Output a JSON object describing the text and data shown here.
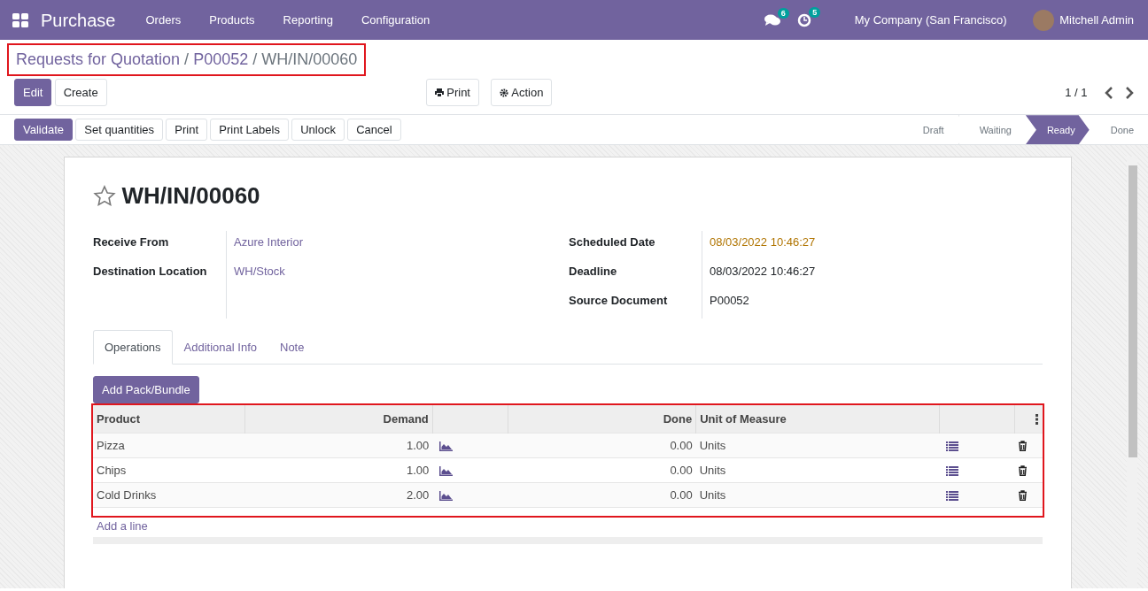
{
  "navbar": {
    "app": "Purchase",
    "menu": [
      "Orders",
      "Products",
      "Reporting",
      "Configuration"
    ],
    "messages_count": "6",
    "activities_count": "5",
    "company": "My Company (San Francisco)",
    "user": "Mitchell Admin"
  },
  "breadcrumb": {
    "highlighted": true,
    "items": [
      {
        "text": "Requests for Quotation",
        "kind": "link"
      },
      {
        "text": "/",
        "kind": "separator"
      },
      {
        "text": "P00052",
        "kind": "link"
      },
      {
        "text": "/",
        "kind": "separator"
      },
      {
        "text": "WH/IN/00060",
        "kind": "current"
      }
    ]
  },
  "control_buttons": [
    {
      "label": "Edit",
      "kind": "primary"
    },
    {
      "label": "Create",
      "kind": "secondary"
    }
  ],
  "action_buttons": [
    {
      "label": "Print",
      "kind": "print"
    },
    {
      "label": "Action",
      "kind": "gear"
    }
  ],
  "pager": "1 / 1",
  "header_buttons": [
    {
      "label": "Validate",
      "kind": "primary"
    },
    {
      "label": "Set quantities",
      "kind": "secondary"
    },
    {
      "label": "Print",
      "kind": "secondary"
    },
    {
      "label": "Print Labels",
      "kind": "secondary"
    },
    {
      "label": "Unlock",
      "kind": "secondary"
    },
    {
      "label": "Cancel",
      "kind": "secondary"
    }
  ],
  "stages": [
    {
      "label": "Draft",
      "selected": false
    },
    {
      "label": "Waiting",
      "selected": false
    },
    {
      "label": "Ready",
      "selected": true
    },
    {
      "label": "Done",
      "selected": false
    }
  ],
  "record": {
    "title": "WH/IN/00060",
    "starred": false,
    "left_fields": [
      {
        "label": "Receive From",
        "value": "Azure Interior",
        "kind": "link"
      },
      {
        "label": "Destination Location",
        "value": "WH/Stock",
        "kind": "link"
      }
    ],
    "right_fields": [
      {
        "label": "Scheduled Date",
        "value": "08/03/2022 10:46:27",
        "kind": "warning"
      },
      {
        "label": "Deadline",
        "value": "08/03/2022 10:46:27",
        "kind": "plain"
      },
      {
        "label": "Source Document",
        "value": "P00052",
        "kind": "plain"
      }
    ]
  },
  "tabs": [
    {
      "label": "Operations",
      "selected": true
    },
    {
      "label": "Additional Info",
      "selected": false
    },
    {
      "label": "Note",
      "selected": false
    }
  ],
  "add_pack_button": "Add Pack/Bundle",
  "table": {
    "highlighted": true,
    "columns": [
      {
        "label": "Product",
        "kind": "text"
      },
      {
        "label": "Demand",
        "kind": "number"
      },
      {
        "kind": "forecast"
      },
      {
        "label": "Done",
        "kind": "number"
      },
      {
        "label": "Unit of Measure",
        "kind": "text"
      },
      {
        "kind": "detail"
      },
      {
        "kind": "options"
      }
    ],
    "rows": [
      {
        "product": "Pizza",
        "demand": "1.00",
        "done": "0.00",
        "uom": "Units"
      },
      {
        "product": "Chips",
        "demand": "1.00",
        "done": "0.00",
        "uom": "Units"
      },
      {
        "product": "Cold Drinks",
        "demand": "2.00",
        "done": "0.00",
        "uom": "Units"
      }
    ],
    "add_line": "Add a line"
  }
}
